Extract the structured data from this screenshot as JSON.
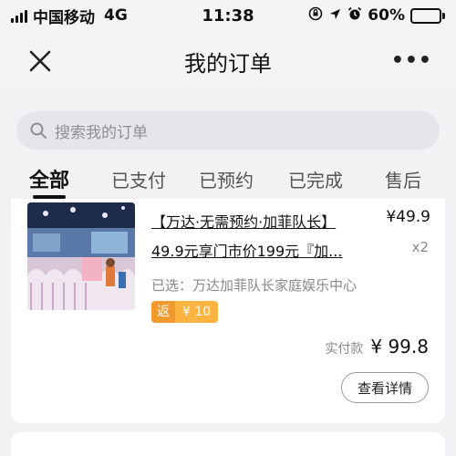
{
  "status_bar": {
    "carrier": "中国移动",
    "network": "4G",
    "time": "11:38",
    "battery_percent": "60%",
    "battery_level": 0.6
  },
  "nav": {
    "title": "我的订单"
  },
  "search": {
    "placeholder": "搜索我的订单"
  },
  "tabs": [
    {
      "label": "全部",
      "active": true
    },
    {
      "label": "已支付"
    },
    {
      "label": "已预约"
    },
    {
      "label": "已完成"
    },
    {
      "label": "售后"
    }
  ],
  "order": {
    "title_line1": "【万达·无需预约·加菲队长】",
    "title_line2": "49.9元享门市价199元『加...",
    "price": "¥49.9",
    "quantity": "x2",
    "selected": "已选：万达加菲队长家庭娱乐中心",
    "rebate_label": "返",
    "rebate_amount": "¥ 10",
    "paid_label": "实付款",
    "paid_amount": "¥ 99.8",
    "detail_button": "查看详情"
  }
}
